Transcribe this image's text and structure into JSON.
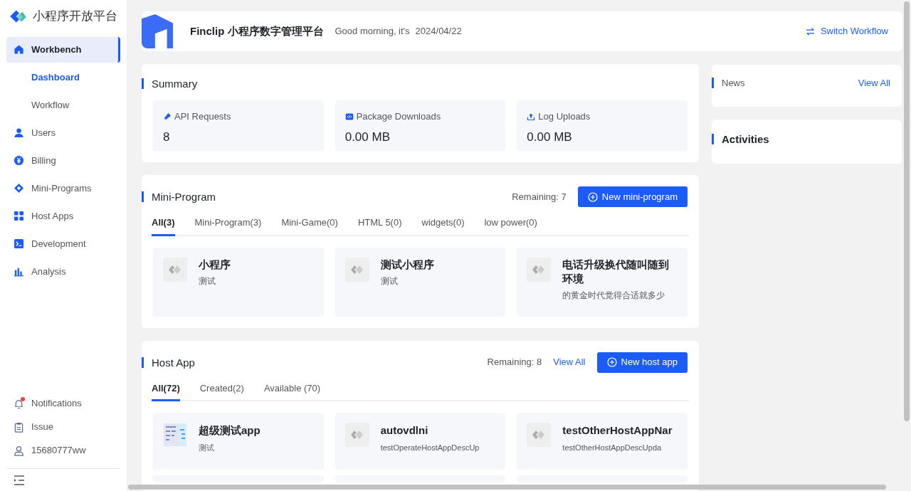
{
  "sidebar": {
    "logo_text": "小程序开放平台",
    "items": [
      {
        "label": "Workbench",
        "selected": true,
        "children": [
          {
            "label": "Dashboard",
            "selected": true
          },
          {
            "label": "Workflow",
            "selected": false
          }
        ]
      },
      {
        "label": "Users",
        "selected": false
      },
      {
        "label": "Billing",
        "selected": false
      },
      {
        "label": "Mini-Programs",
        "selected": false
      },
      {
        "label": "Host Apps",
        "selected": false
      },
      {
        "label": "Development",
        "selected": false
      },
      {
        "label": "Analysis",
        "selected": false
      }
    ],
    "bottom_items": [
      {
        "label": "Notifications",
        "alert": true
      },
      {
        "label": "Issue",
        "alert": false
      },
      {
        "label": "15680777ww",
        "alert": false
      }
    ]
  },
  "header": {
    "title": "Finclip 小程序数字管理平台",
    "greeting": "Good morning, it's",
    "date": "2024/04/22",
    "switch_button": "Switch Workflow"
  },
  "summary": {
    "title": "Summary",
    "stats": [
      {
        "label": "API Requests",
        "value": "8"
      },
      {
        "label": "Package Downloads",
        "value": "0.00 MB"
      },
      {
        "label": "Log Uploads",
        "value": "0.00 MB"
      }
    ]
  },
  "mini_program": {
    "title": "Mini-Program",
    "remaining": "Remaining: 7",
    "button": "New mini-program",
    "tabs": [
      {
        "label": "All(3)",
        "selected": true
      },
      {
        "label": "Mini-Program(3)",
        "selected": false
      },
      {
        "label": "Mini-Game(0)",
        "selected": false
      },
      {
        "label": "HTML 5(0)",
        "selected": false
      },
      {
        "label": "widgets(0)",
        "selected": false
      },
      {
        "label": "low power(0)",
        "selected": false
      }
    ],
    "cards": [
      {
        "name": "小程序",
        "desc": "测试"
      },
      {
        "name": "测试小程序",
        "desc": "测试"
      },
      {
        "name": "电话升级换代随叫随到环境",
        "desc": "的黄金时代觉得合适就多少"
      }
    ]
  },
  "host_app": {
    "title": "Host App",
    "remaining": "Remaining: 8",
    "view_all": "View All",
    "button": "New host app",
    "tabs": [
      {
        "label": "All(72)",
        "selected": true
      },
      {
        "label": "Created(2)",
        "selected": false
      },
      {
        "label": "Available (70)",
        "selected": false
      }
    ],
    "cards": [
      {
        "name": "超级测试app",
        "desc": "测试",
        "kind": "thumbnail"
      },
      {
        "name": "autovdlni",
        "desc": "testOperateHostAppDescUp",
        "kind": "placeholder"
      },
      {
        "name": "testOtherHostAppNar",
        "desc": "testOtherHostAppDescUpda",
        "kind": "placeholder"
      }
    ]
  },
  "news": {
    "title": "News",
    "view_all": "View All"
  },
  "activities": {
    "title": "Activities"
  }
}
